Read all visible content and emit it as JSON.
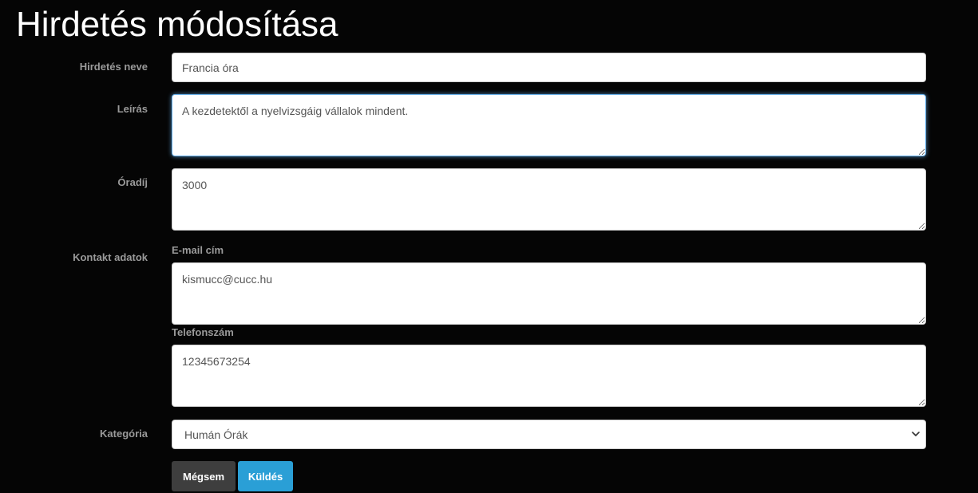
{
  "page": {
    "title": "Hirdetés módosítása"
  },
  "form": {
    "name": {
      "label": "Hirdetés neve",
      "value": "Francia óra"
    },
    "description": {
      "label": "Leírás",
      "value": "A kezdetektől a nyelvizsgáig vállalok mindent."
    },
    "hourly_rate": {
      "label": "Óradíj",
      "value": "3000"
    },
    "contact": {
      "label": "Kontakt adatok",
      "email_label": "E-mail cím",
      "email_value": "kismucc@cucc.hu",
      "phone_label": "Telefonszám",
      "phone_value": "12345673254"
    },
    "category": {
      "label": "Kategória",
      "selected": "Humán Órák",
      "icon": "chevron-down-icon"
    },
    "buttons": {
      "cancel_label": "Mégsem",
      "submit_label": "Küldés"
    }
  },
  "colors": {
    "background": "#050505",
    "title": "#ffffff",
    "label": "#9a9a9a",
    "cancel_button": "#3e3e3e",
    "submit_button": "#2a9fd6",
    "focus_border": "#66afe9"
  }
}
